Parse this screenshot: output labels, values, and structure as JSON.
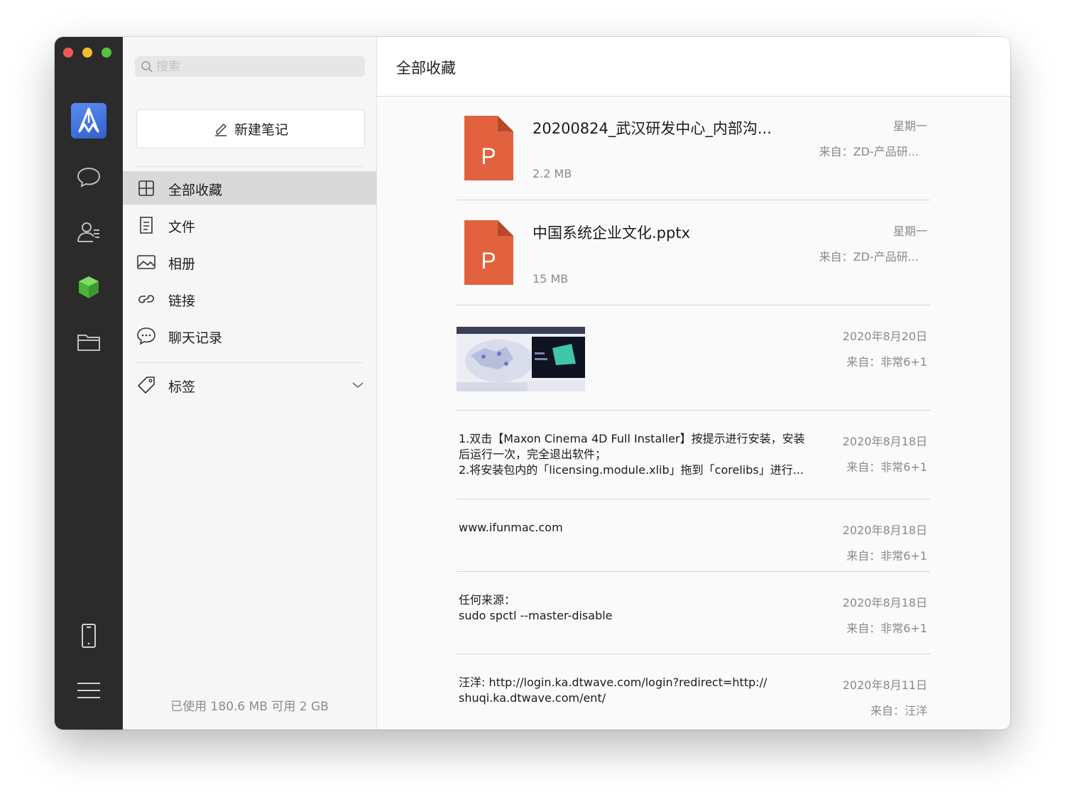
{
  "sidebar": {
    "search_placeholder": "搜索",
    "new_note_label": "新建笔记",
    "nav_items": [
      {
        "label": "全部收藏",
        "icon": "grid-icon",
        "active": true
      },
      {
        "label": "文件",
        "icon": "file-icon",
        "active": false
      },
      {
        "label": "相册",
        "icon": "image-icon",
        "active": false
      },
      {
        "label": "链接",
        "icon": "link-icon",
        "active": false
      },
      {
        "label": "聊天记录",
        "icon": "chat-bubble-icon",
        "active": false
      }
    ],
    "tags_label": "标签",
    "storage_text": "已使用 180.6 MB 可用 2 GB"
  },
  "rail": {
    "icons": [
      "app-logo-icon",
      "chat-icon",
      "contacts-icon",
      "favorites-cube-icon",
      "folder-icon",
      "phone-icon",
      "menu-icon"
    ],
    "accent_color": "#57c33c"
  },
  "main": {
    "title": "全部收藏",
    "items": [
      {
        "type": "file",
        "name": "20200824_武汉研发中心_内部沟...",
        "size": "2.2 MB",
        "date": "星期一",
        "source": "来自：ZD-产品研..."
      },
      {
        "type": "file",
        "name": "中国系统企业文化.pptx",
        "size": "15 MB",
        "date": "星期一",
        "source": "来自：ZD-产品研..."
      },
      {
        "type": "image",
        "date": "2020年8月20日",
        "source": "来自：非常6+1"
      },
      {
        "type": "text",
        "lines": [
          "1.双击【Maxon Cinema 4D Full Installer】按提示进行安装，安装",
          "后运行一次，完全退出软件；",
          "2.将安装包内的「licensing.module.xlib」拖到「corelibs」进行..."
        ],
        "date": "2020年8月18日",
        "source": "来自：非常6+1"
      },
      {
        "type": "text",
        "lines": [
          "www.ifunmac.com"
        ],
        "date": "2020年8月18日",
        "source": "来自：非常6+1"
      },
      {
        "type": "text",
        "lines": [
          "任何来源：",
          "sudo spctl --master-disable"
        ],
        "date": "2020年8月18日",
        "source": "来自：非常6+1"
      },
      {
        "type": "text",
        "lines": [
          "汪洋: http://login.ka.dtwave.com/login?redirect=http://",
          "shuqi.ka.dtwave.com/ent/"
        ],
        "date": "2020年8月11日",
        "source": "来自：汪洋"
      }
    ],
    "ppt_badge_letter": "P",
    "ppt_color": "#e2623f"
  }
}
